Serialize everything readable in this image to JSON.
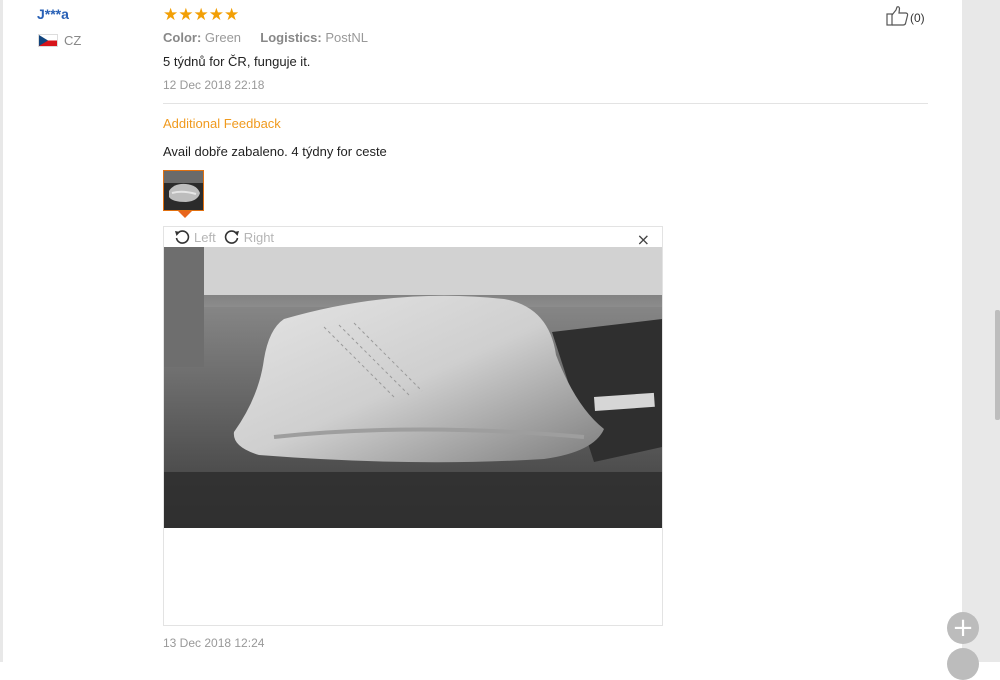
{
  "review": {
    "user_name": "J***a",
    "country": "CZ",
    "rating": 5,
    "stars_text": "★★★★★",
    "like_count": "(0)",
    "color_label": "Color:",
    "color_value": "Green",
    "logistics_label": "Logistics:",
    "logistics_value": "PostNL",
    "text": "5 týdnů for ČR, funguje it.",
    "date": "12 Dec 2018 22:18"
  },
  "additional": {
    "title": "Additional Feedback",
    "text": "Avail dobře zabaleno. 4 týdny for ceste",
    "date": "13 Dec 2018 12:24"
  },
  "viewer": {
    "rotate_left_label": "Left",
    "rotate_right_label": "Right",
    "close_glyph": "×"
  },
  "floating": {
    "plus_glyph": "+"
  },
  "colors": {
    "accent_orange": "#f09a1e",
    "user_blue": "#2860b6",
    "star_orange": "#f29f05"
  },
  "icons": [
    "flag-cz-icon",
    "thumbs-up-icon",
    "rotate-left-icon",
    "rotate-right-icon",
    "close-icon",
    "plus-icon"
  ]
}
